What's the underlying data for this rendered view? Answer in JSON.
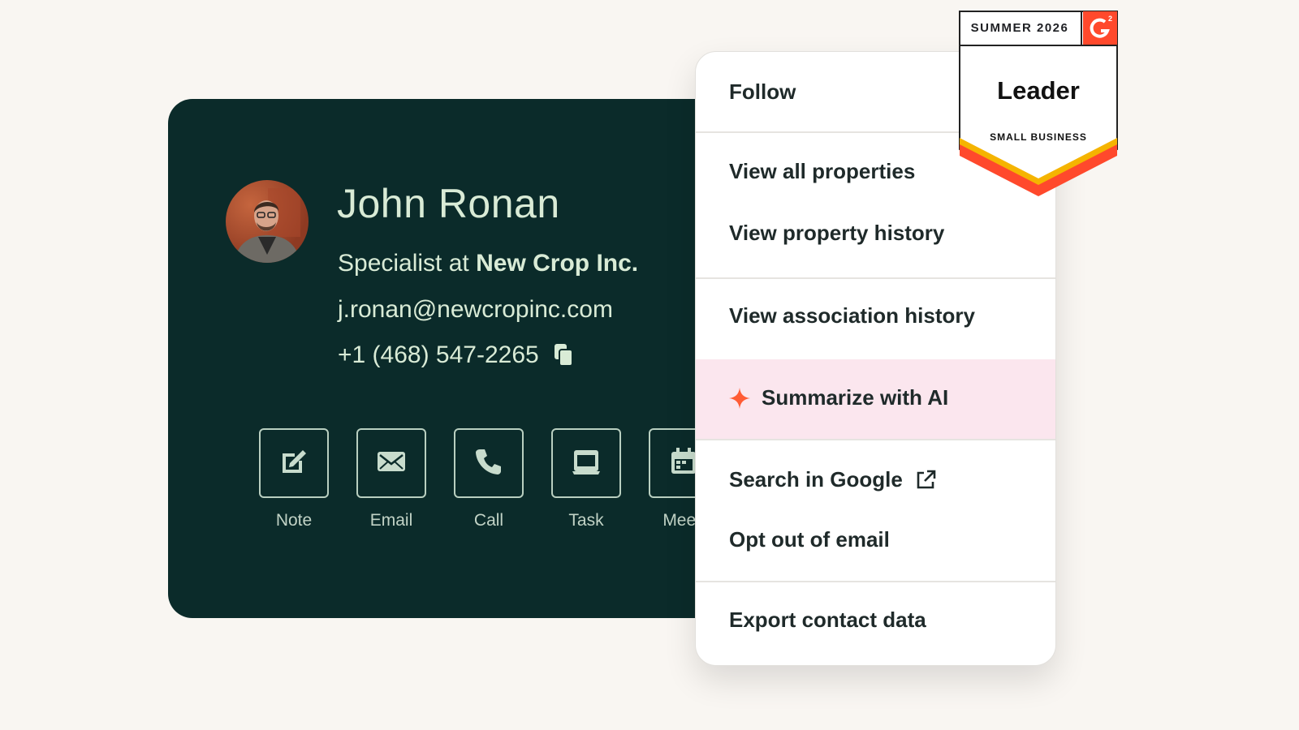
{
  "contact": {
    "name": "John Ronan",
    "title_prefix": "Specialist at ",
    "company": "New Crop Inc.",
    "email": "j.ronan@newcropinc.com",
    "phone": "+1 (468) 547-2265"
  },
  "actions": [
    {
      "label": "Note",
      "icon": "note-icon"
    },
    {
      "label": "Email",
      "icon": "email-icon"
    },
    {
      "label": "Call",
      "icon": "call-icon"
    },
    {
      "label": "Task",
      "icon": "task-icon"
    },
    {
      "label": "Meeti",
      "icon": "meeting-icon"
    }
  ],
  "menu": {
    "follow": "Follow",
    "view_all_properties": "View all properties",
    "view_property_history": "View property history",
    "view_association_history": "View association history",
    "summarize_ai": "Summarize with AI",
    "search_google": "Search in Google",
    "opt_out_email": "Opt out of email",
    "export_contact": "Export contact data"
  },
  "badge": {
    "season": "SUMMER 2026",
    "title": "Leader",
    "subtitle": "SMALL BUSINESS",
    "logo": "G2"
  },
  "colors": {
    "card_bg": "#0b2b2a",
    "card_text": "#d9ebd6",
    "ai_highlight": "#fbe6ee",
    "sparkle": "#ff5c35",
    "g2_red": "#ff492c"
  }
}
